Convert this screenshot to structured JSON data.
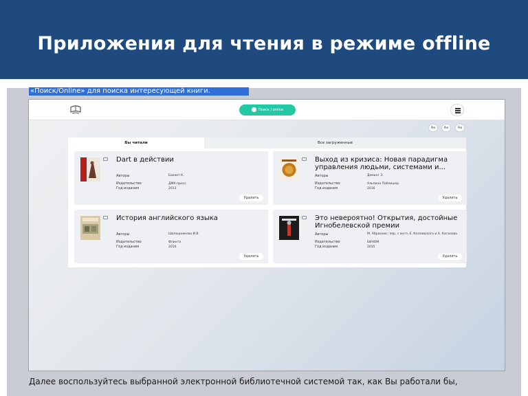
{
  "slide": {
    "title": "Приложения для чтения в режиме offline",
    "caption_top": "«Поиск/Online» для поиска интересующей книги.",
    "caption_bottom": "Далее воспользуйтесь выбранной электронной библиотечной системой так, как Вы работали бы,"
  },
  "colors": {
    "title_bar": "#1e4a7e",
    "accent": "#22c9a4"
  },
  "app": {
    "search_button_label": "Поиск / online",
    "logo_icon": "library-logo-icon",
    "menu_icon": "hamburger-menu-icon",
    "font_buttons": [
      "Aa",
      "Aa",
      "Aa"
    ],
    "tabs": [
      "Вы читали",
      "Все загруженные"
    ],
    "meta_labels": {
      "authors": "Авторы",
      "publisher": "Издательство",
      "year": "Год издания"
    },
    "delete_label": "Удалить",
    "books": [
      {
        "title": "Dart в действии",
        "authors": "Баккет К.",
        "publisher": "ДМК-пресс",
        "year": "2013"
      },
      {
        "title": "Выход из кризиса: Новая парадигма управления людьми, системами и...",
        "authors": "Деминг Э.",
        "publisher": "Альпина Паблишер",
        "year": "2016"
      },
      {
        "title": "История английского языка",
        "authors": "Шапошникова И.В.",
        "publisher": "Флинта",
        "year": "2016"
      },
      {
        "title": "Это невероятно! Открытия, достойные Игнобелевской премии",
        "authors": "М. Абрахамс; пер. с англ. Е. Козловского и А. Каганова",
        "publisher": "БИНОМ",
        "year": "2015"
      }
    ]
  }
}
